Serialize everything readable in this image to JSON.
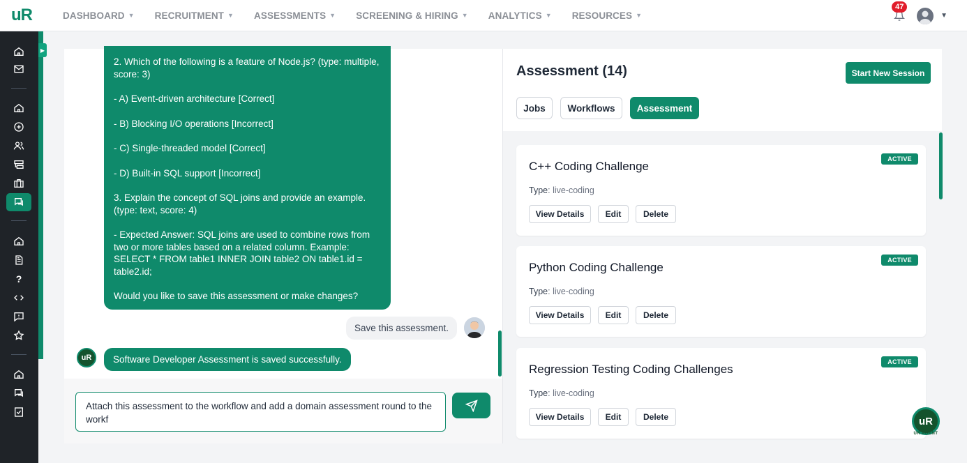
{
  "brand": {
    "logo": "uR",
    "accent": "#0f8a6b"
  },
  "nav": {
    "items": [
      "DASHBOARD",
      "RECRUITMENT",
      "ASSESSMENTS",
      "SCREENING & HIRING",
      "ANALYTICS",
      "RESOURCES"
    ],
    "notifications": "47"
  },
  "sidebar": {
    "icons": [
      "home-icon",
      "mail-icon",
      "home-icon",
      "plus-circle-icon",
      "users-icon",
      "workflow-icon",
      "briefcase-icon",
      "chat-icon",
      "home-icon",
      "document-icon",
      "question-icon",
      "code-icon",
      "message-icon",
      "star-icon",
      "home-icon",
      "chat-icon",
      "checklist-icon"
    ]
  },
  "chat": {
    "bot_message": [
      "2. Which of the following is a feature of Node.js? (type: multiple, score: 3)",
      "- A) Event-driven architecture [Correct]",
      "- B) Blocking I/O operations [Incorrect]",
      "- C) Single-threaded model [Correct]",
      "- D) Built-in SQL support [Incorrect]",
      "3. Explain the concept of SQL joins and provide an example. (type: text, score: 4)",
      "- Expected Answer: SQL joins are used to combine rows from two or more tables based on a related column. Example: SELECT * FROM table1 INNER JOIN table2 ON table1.id = table2.id;",
      "Would you like to save this assessment or make changes?"
    ],
    "user_message": "Save this assessment.",
    "bot_reply": "Software Developer Assessment is saved successfully.",
    "input_value": "Attach this assessment to the workflow and add a domain assessment round to the workf"
  },
  "assessment": {
    "title": "Assessment (14)",
    "start_label": "Start New Session",
    "tabs": [
      "Jobs",
      "Workflows",
      "Assessment"
    ],
    "active_tab": "Assessment",
    "type_label": "Type",
    "cards": [
      {
        "title": "C++ Coding Challenge",
        "type": "live-coding",
        "status": "ACTIVE"
      },
      {
        "title": "Python Coding Challenge",
        "type": "live-coding",
        "status": "ACTIVE"
      },
      {
        "title": "Regression Testing Coding Challenges",
        "type": "live-coding",
        "status": "ACTIVE"
      }
    ],
    "actions": [
      "View Details",
      "Edit",
      "Delete"
    ]
  },
  "agent": {
    "logo": "uR",
    "label": "UR AGENT"
  }
}
